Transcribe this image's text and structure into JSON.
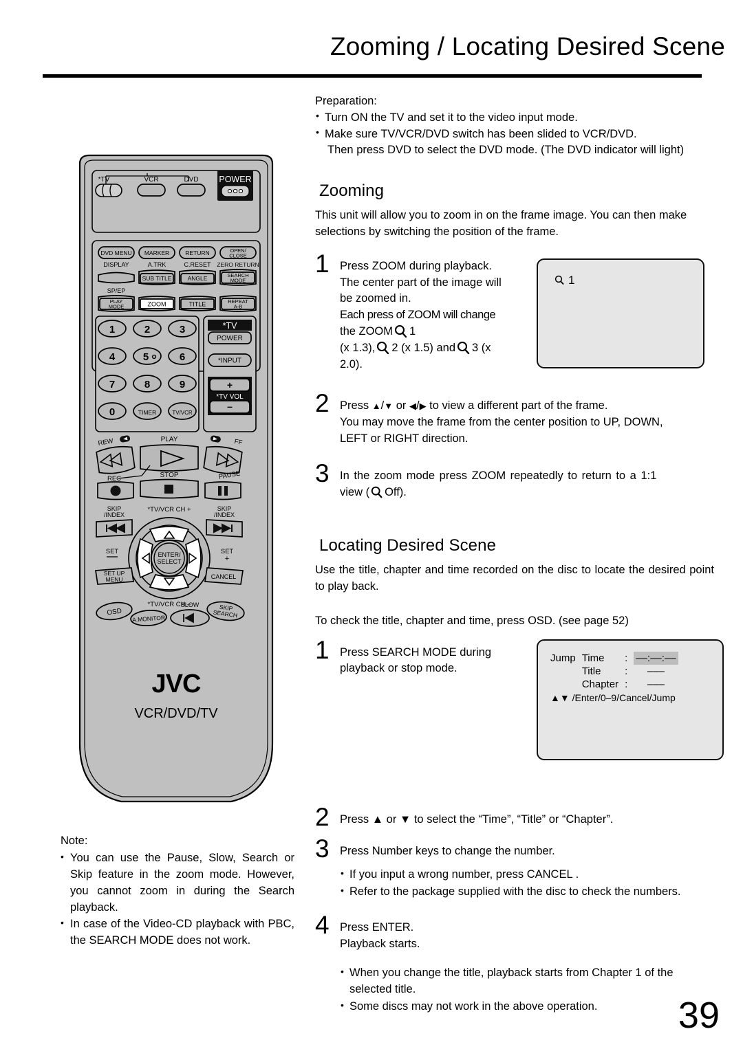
{
  "page": {
    "title": "Zooming / Locating Desired Scene",
    "number": "39"
  },
  "preparation": {
    "label": "Preparation:",
    "items": [
      "Turn ON the TV and set it to the video input mode.",
      "Make sure TV/VCR/DVD switch has been slided to VCR/DVD.",
      "Then press DVD to select the DVD mode. (The DVD indicator will light)"
    ]
  },
  "zooming": {
    "heading": "Zooming",
    "intro": "This unit will allow you to zoom in on the frame image. You can then make selections by switching the position of the frame.",
    "steps": [
      {
        "num": "1",
        "lines": [
          "Press ZOOM during playback.",
          "The center part of the image will",
          "be zoomed in.",
          "Each press of ZOOM will change",
          "the ZOOM",
          "1",
          "(x 1.3),",
          "2 (x 1.5) and",
          "3 (x",
          "2.0)."
        ]
      },
      {
        "num": "2",
        "line1_a": "Press",
        "line1_b": "/",
        "line1_c": "or",
        "line1_d": "/",
        "line1_e": "to view a different part of the frame.",
        "line2": "You may move the frame from the center position to UP, DOWN,",
        "line3": "LEFT or RIGHT direction."
      },
      {
        "num": "3",
        "line1": "In the zoom mode press ZOOM repeatedly to return to a 1:1",
        "line2_a": "view (",
        "line2_b": "Off)."
      }
    ],
    "screen": {
      "name": "zoom-level-osd",
      "icon": "magnifier-icon",
      "level": "1"
    }
  },
  "locating": {
    "heading": "Locating Desired Scene",
    "intro": "Use the title, chapter and time recorded on the disc to locate the desired point to play back.",
    "osd_note": "To check the title, chapter and time, press OSD. (see page 52)",
    "steps": [
      {
        "num": "1",
        "line1": "Press SEARCH MODE  during",
        "line2": "playback or stop mode."
      },
      {
        "num": "2",
        "text": "Press ▲ or ▼ to select the “Time”, “Title” or “Chapter”."
      },
      {
        "num": "3",
        "text": "Press Number keys  to change the number.",
        "bullets": [
          "If you input a wrong number, press CANCEL .",
          "Refer to the package supplied with the disc to check the numbers."
        ]
      },
      {
        "num": "4",
        "line1": "Press ENTER.",
        "line2": "Playback starts.",
        "bullets": [
          "When you change the title, playback starts from Chapter 1 of the selected title.",
          "Some discs may not work in the above operation."
        ]
      }
    ],
    "screen": {
      "name": "jump-search-osd",
      "jump_label": "Jump",
      "rows": [
        {
          "label": "Time",
          "colon": ":",
          "value": "––:––:––",
          "highlight": true
        },
        {
          "label": "Title",
          "colon": ":",
          "value": "–––",
          "highlight": false
        },
        {
          "label": "Chapter",
          "colon": ":",
          "value": "–––",
          "highlight": false
        }
      ],
      "hint": "▲▼ /Enter/0–9/Cancel/Jump"
    }
  },
  "note": {
    "label": "Note:",
    "items": [
      "You can use the Pause, Slow, Search or Skip feature in the zoom mode. However, you cannot zoom in during the Search playback.",
      "In case of the Video-CD playback with PBC, the SEARCH MODE does not work."
    ]
  },
  "remote": {
    "brand": "JVC",
    "model_line": "VCR/DVD/TV",
    "top_row": {
      "tv_label": "*TV",
      "vcr_label": "VCR",
      "dvd_label": "DVD",
      "power_label": "POWER"
    },
    "function_rows": [
      [
        "DVD MENU",
        "MARKER",
        "RETURN",
        "OPEN/\nCLOSE"
      ],
      [
        "DISPLAY",
        "A.TRK",
        "C.RESET",
        "ZERO RETURN"
      ],
      [
        "",
        "SUB TITLE",
        "ANGLE",
        "SEARCH\nMODE"
      ],
      [
        "SP/EP",
        "",
        "",
        ""
      ],
      [
        "PLAY\nMODE",
        "ZOOM",
        "TITLE",
        "REPEAT\nA-B"
      ]
    ],
    "keypad": [
      "1",
      "2",
      "3",
      "4",
      "5°",
      "6",
      "7",
      "8",
      "9",
      "0",
      "TIMER",
      "TV/VCR"
    ],
    "tv_panel": {
      "header": "*TV",
      "power": "POWER",
      "input": "*INPUT",
      "vol_plus": "+",
      "vol_label": "*TV VOL",
      "vol_minus": "–"
    },
    "transport": {
      "rew": "REW",
      "play": "PLAY",
      "ff": "FF",
      "rec": "REC",
      "stop": "STOP",
      "pause": "PAUSE"
    },
    "nav": {
      "skip_index_left": "SKIP\n/INDEX",
      "skip_index_right": "SKIP\n/INDEX",
      "ch_up": "*TV/VCR CH +",
      "ch_down": "*TV/VCR CH –",
      "set_minus": "SET\n–",
      "set_plus": "SET\n+",
      "enter": "ENTER/\nSELECT",
      "setup_menu": "SET UP\nMENU",
      "cancel": "CANCEL",
      "osd": "OSD",
      "a_monitor": "A.MONITOR",
      "slow": "SLOW",
      "skip_search": "SKIP\nSEARCH"
    }
  },
  "colors": {
    "remote_body": "#c0c0c0",
    "button_face": "#b9b9b9",
    "screen_bg": "#e6e6e6",
    "dark_panel": "#1a1a1a",
    "highlight": "#bdbdbd",
    "ink": "#000000"
  }
}
